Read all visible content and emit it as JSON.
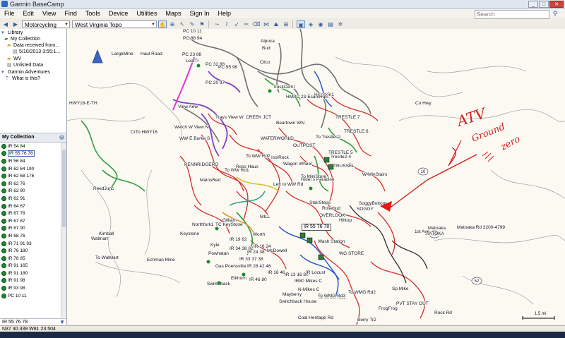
{
  "window": {
    "title": "Garmin BaseCamp",
    "minimize": "_",
    "maximize": "□",
    "close": "✕"
  },
  "menu": {
    "items": [
      "File",
      "Edit",
      "View",
      "Find",
      "Tools",
      "Device",
      "Utilities",
      "Maps",
      "Sign In",
      "Help"
    ],
    "search_placeholder": "Search",
    "search_icon": "magnifier-icon"
  },
  "toolbar": {
    "profile": "Motorcycling",
    "map_product": "West Virginia Topo"
  },
  "library": {
    "items": [
      {
        "label": "Library",
        "icon": "library-icon"
      },
      {
        "label": "My Collection",
        "icon": "collection-icon"
      },
      {
        "label": "Data received from...",
        "icon": "folder-icon"
      },
      {
        "label": "5/10/2013 3:55:1...",
        "icon": "list-icon"
      },
      {
        "label": "WV",
        "icon": "folder-icon"
      },
      {
        "label": "Unlisted Data",
        "icon": "list-icon"
      },
      {
        "label": "Garmin Adventures",
        "icon": "adventure-icon"
      },
      {
        "label": "What is this?",
        "icon": "help-icon"
      }
    ]
  },
  "collection": {
    "header": "My Collection",
    "items": [
      "IR 54 84",
      "IR 55 76 78",
      "IR 56 84",
      "IR 62 64 190",
      "IR 62 68 176",
      "IR 62 76",
      "IR 62 90",
      "IR 62 91",
      "IR 64 67",
      "IR 67 78",
      "IR 67 87",
      "IR 67 90",
      "IR 68 76",
      "IR 71 91 93",
      "IR 76 180",
      "IR 78 85",
      "IR 91 165",
      "IR 91 180",
      "IR 91 98",
      "IR 93 98",
      "PC 10 11"
    ],
    "selected_index": 1,
    "filter_value": "IR 55 76 78"
  },
  "status": {
    "coords": "N37 30.339 W81 23.504"
  },
  "map": {
    "scale": "1.5 mi",
    "selected_callout": "IR 55 76 78",
    "annotation": {
      "line1": "ATV",
      "line2": "Ground",
      "line3": "zero"
    },
    "labels": [
      "LargeMine",
      "Haul Road",
      "PC 10 11",
      "PC 88 94",
      "PC 23 88",
      "LeafTr",
      "PC 32 88",
      "PC 95 96",
      "PC 20 97",
      "Alpoca",
      "Bud",
      "Cilco",
      "LuskCemt",
      "Heindon1",
      "HMPC 23-EsamHgts",
      "Co Hwy",
      "TRESTLE 7",
      "TRESTLE 6",
      "HWY16-E-TH",
      "View Aew",
      "Trays View W",
      "CREEK JCT",
      "Beartown WN",
      "Welch W View N",
      "CrTo HWY16",
      "WW E Burke S",
      "WATERWORLD",
      "OUTPOST",
      "To Trestles2",
      "TRESTLE 5",
      "Trestle2-4",
      "TRUSSEL",
      "To WW Rd2",
      "IsolRock",
      "To WW Rd1",
      "Wagon Wheel",
      "PENNRIDGERO",
      "Ross Haus",
      "Left to WW Rd",
      "Rider's Paradise",
      "To MiniStore",
      "W-MinStairs",
      "MainsRed",
      "ReedJunc",
      "SoggyBottom",
      "SOGGY",
      "StairSteps",
      "Rosebud",
      "OVERLOOK",
      "Hilltop",
      "MILL",
      "Gilliam",
      "Northfork1",
      "TC KeyStone",
      "Worth",
      "Kimball",
      "Walmart",
      "Wash Station",
      "Keystone",
      "WG STORE",
      "Matoaka",
      "MATOKA",
      "Matoaka Rd 3200-4799",
      "1st Ave",
      "To WalMart",
      "Echman Mine",
      "Kyle",
      "Powhatan",
      "McDowell",
      "Gas Poensville",
      "Elkhorn",
      "Switchback",
      "N-Mikes C",
      "To WMG Rd2",
      "To WMG Rd1",
      "To WMG Rd3",
      "Switchback House",
      "Mayberry",
      "PVT STAY OUT",
      "FrogFrog",
      "Rock Rd",
      "Berry Tr2",
      "Coal Heritage Rd",
      "Sp Mike"
    ],
    "route_labels": [
      "IR 19 82",
      "IR 34 38 82",
      "IR 16 24",
      "IR 24 38",
      "IR 33 37 38",
      "IR 28 42 46",
      "IR 16 46",
      "IR 13 16 80",
      "IR 46 80",
      "IR80 Mikes C",
      "IR Locust",
      "IR 55 76 78"
    ],
    "highway_shields": [
      "10",
      "10",
      "52"
    ],
    "route_colors": {
      "red": "#d42c2c",
      "purple": "#7b3fc7",
      "gray": "#6f6f6f",
      "green": "#2f9e3a",
      "blue": "#2a57c9",
      "magenta": "#d93ad0",
      "teal": "#2b9c8e",
      "yellow": "#d8c21e",
      "orange": "#e88a1a",
      "black": "#222222"
    }
  }
}
